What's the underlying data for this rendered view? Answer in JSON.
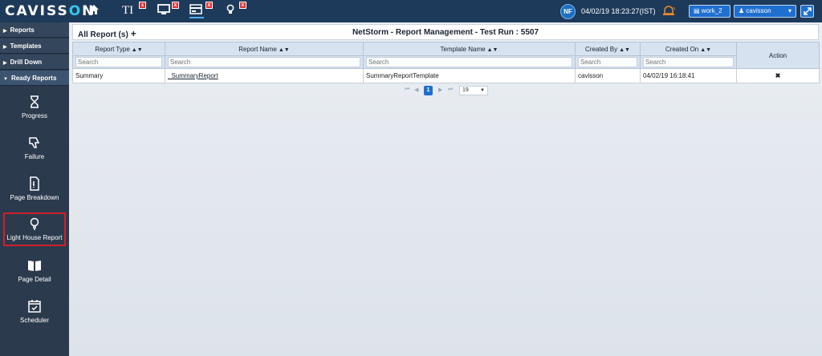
{
  "brand": {
    "name_main": "CAVISS",
    "name_o": "O",
    "name_end": "N"
  },
  "toolbar": {
    "icons": [
      "home-icon",
      "text-icon",
      "monitor-icon",
      "dashboard-icon",
      "lightbulb-icon"
    ],
    "text_icon_label": "TI"
  },
  "header": {
    "badge": "NF",
    "datetime": "04/02/19 18:23:27(IST)",
    "workspace": "work_2",
    "user": "cavisson"
  },
  "sidebar": {
    "menus": [
      {
        "label": "Reports",
        "open": false
      },
      {
        "label": "Templates",
        "open": false
      },
      {
        "label": "Drill Down",
        "open": false
      },
      {
        "label": "Ready Reports",
        "open": true
      }
    ],
    "items": [
      {
        "label": "Progress",
        "icon": "hourglass-icon"
      },
      {
        "label": "Failure",
        "icon": "thumbs-down-icon"
      },
      {
        "label": "Page Breakdown",
        "icon": "document-icon"
      },
      {
        "label": "Light House Report",
        "icon": "lightbulb-icon",
        "selected": true
      },
      {
        "label": "Page Detail",
        "icon": "open-book-icon"
      },
      {
        "label": "Scheduler",
        "icon": "calendar-check-icon"
      }
    ]
  },
  "main": {
    "all_reports_label": "All Report (s)",
    "title": "NetStorm - Report Management - Test Run : 5507",
    "columns": [
      "Report Type",
      "Report Name",
      "Template Name",
      "Created By",
      "Created On",
      "Action"
    ],
    "search_placeholder": "Search",
    "rows": [
      {
        "report_type": "Summary",
        "report_name": "_SummaryReport",
        "template_name": "SummaryReportTemplate",
        "created_by": "cavisson",
        "created_on": "04/02/19 16:18:41",
        "action": "✖"
      }
    ],
    "pager": {
      "first": "⏮",
      "prev": "◀",
      "page": "1",
      "next": "▶",
      "last": "⏭",
      "page_size": "19"
    }
  },
  "colors": {
    "topbar": "#1e3a5a",
    "sidebar": "#2b3a4d",
    "accent": "#1f6fd0",
    "selected_border": "#d0202a",
    "delete": "#e02020"
  }
}
